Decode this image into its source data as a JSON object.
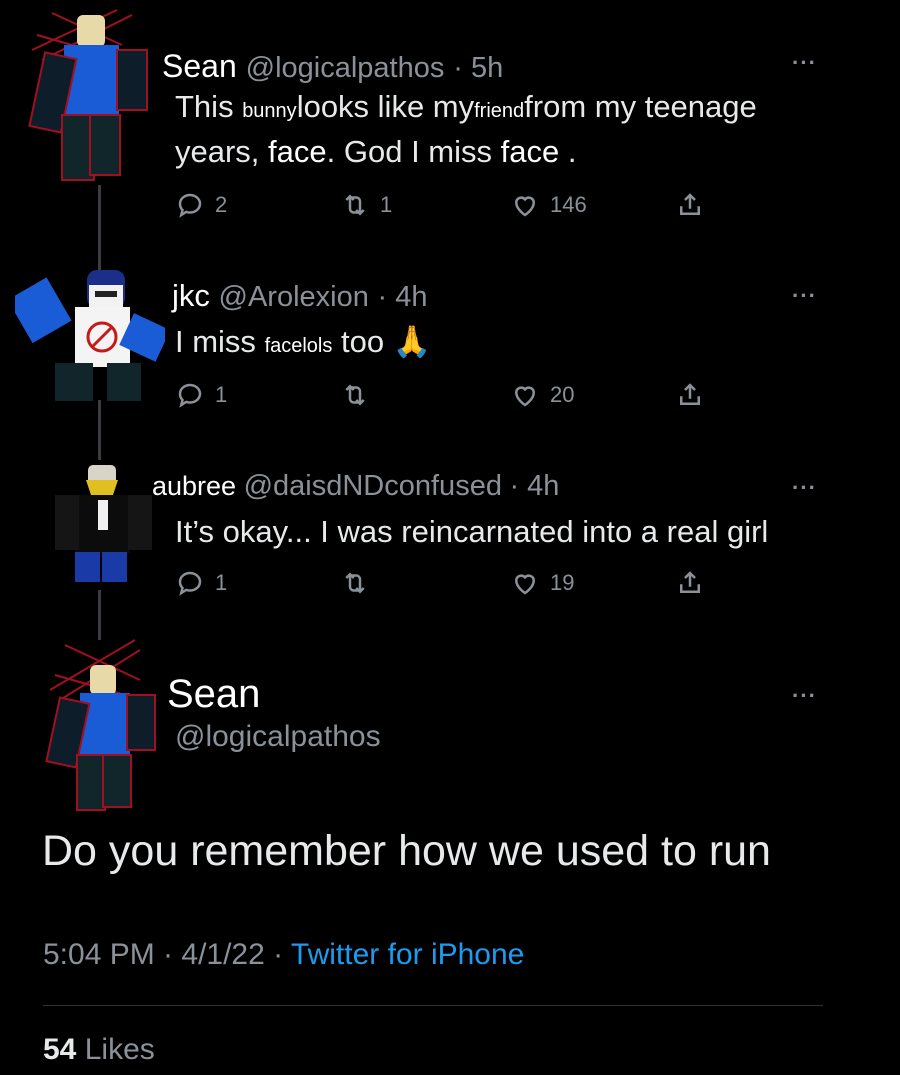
{
  "tweets": [
    {
      "name": "Sean",
      "handle": "@logicalpathos",
      "time": "· 5h",
      "line1": [
        "This ",
        "bunny",
        "looks like my",
        "friend",
        "from my teenage"
      ],
      "line2": [
        "years, ",
        "face",
        ". God I miss ",
        "face",
        " ."
      ],
      "replies": "2",
      "retweets": "1",
      "likes": "146"
    },
    {
      "name": "jkc",
      "handle": "@Arolexion",
      "time": "· 4h",
      "text": [
        "I miss ",
        "facelols",
        " too ",
        "🙏"
      ],
      "replies": "1",
      "retweets": "",
      "likes": "20"
    },
    {
      "name": "aubree",
      "handle": "@daisdNDconfused",
      "time": "· 4h",
      "text": "It’s okay... I was reincarnated into a real girl",
      "replies": "1",
      "retweets": "",
      "likes": "19"
    }
  ],
  "main": {
    "name": "Sean",
    "handle": "@logicalpathos",
    "text": "Do you remember how we used to run",
    "time": "5:04 PM · 4/1/22 · ",
    "source": "Twitter for iPhone",
    "likes_count": "54",
    "likes_label": "Likes"
  },
  "more_glyph": "···",
  "colors": {
    "accent": "#1d9bf0",
    "secondary": "#8b9198",
    "background": "#000000"
  }
}
